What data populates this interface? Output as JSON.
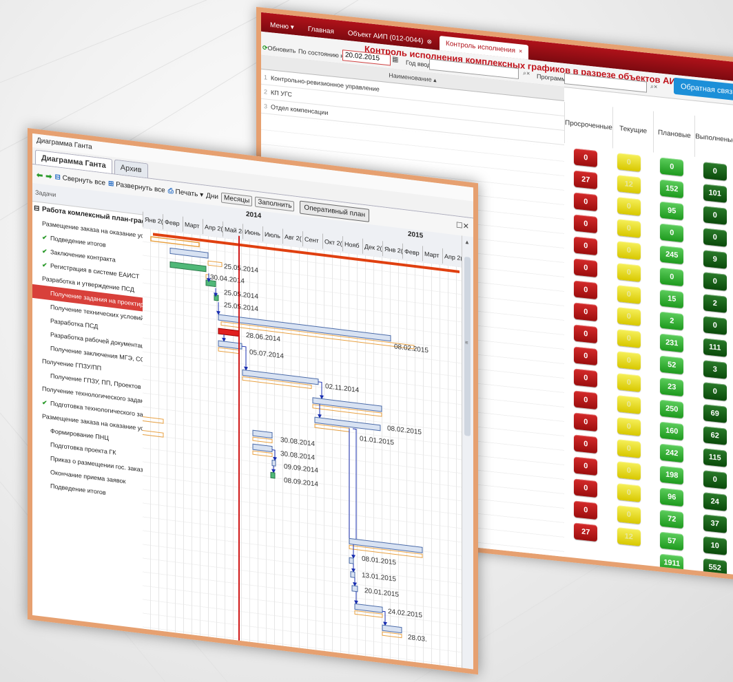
{
  "back_window": {
    "tabs": [
      {
        "label": "Меню ▾",
        "active": false,
        "closable": false
      },
      {
        "label": "Главная",
        "active": false,
        "closable": false
      },
      {
        "label": "Объект АИП (012-0044)",
        "active": false,
        "closable": true
      },
      {
        "label": "Контроль исполнения",
        "active": true,
        "closable": true
      }
    ],
    "title": "Контроль исполнения комплексных графиков в разрезе объектов АИП",
    "refresh_label": "Обновить",
    "state_label": "По состоянию на:",
    "state_date": "20.02.2015",
    "year_label": "Год ввода:",
    "program_label": "Программа:",
    "feedback_label": "Обратная связь",
    "name_column": "Наименование ▴",
    "rows": [
      {
        "n": "1",
        "label": "Контрольно-ревизионное управление"
      },
      {
        "n": "2",
        "label": "КП УГС"
      },
      {
        "n": "3",
        "label": "Отдел компенсации"
      }
    ],
    "status_headers": [
      "Просроченные",
      "Текущие",
      "Плановые",
      "Выполненые"
    ],
    "status_rows": [
      [
        "0",
        "0",
        "0",
        "0"
      ],
      [
        "27",
        "12",
        "152",
        "101"
      ],
      [
        "0",
        "0",
        "95",
        "0"
      ],
      [
        "0",
        "0",
        "0",
        "0"
      ],
      [
        "0",
        "0",
        "245",
        "9"
      ],
      [
        "0",
        "0",
        "0",
        "0"
      ],
      [
        "0",
        "0",
        "15",
        "2"
      ],
      [
        "0",
        "0",
        "2",
        "0"
      ],
      [
        "0",
        "0",
        "231",
        "111"
      ],
      [
        "0",
        "0",
        "52",
        "3"
      ],
      [
        "0",
        "0",
        "23",
        "0"
      ],
      [
        "0",
        "0",
        "250",
        "69"
      ],
      [
        "0",
        "0",
        "160",
        "62"
      ],
      [
        "0",
        "0",
        "242",
        "115"
      ],
      [
        "0",
        "0",
        "198",
        "0"
      ],
      [
        "0",
        "0",
        "96",
        "24"
      ],
      [
        "0",
        "0",
        "72",
        "37"
      ],
      [
        "27",
        "12",
        "57",
        "10"
      ],
      [
        "",
        "",
        "1911",
        "552"
      ]
    ],
    "colors": {
      "overdue": "#c01818",
      "current": "#e8dc10",
      "planned": "#2aa52a",
      "done": "#0c5a0c"
    }
  },
  "front_window": {
    "window_title": "Диаграмма Ганта",
    "tabs": [
      {
        "label": "Диаграмма Ганта",
        "active": true
      },
      {
        "label": "Архив",
        "active": false
      }
    ],
    "toolbar": {
      "collapse_all": "Свернуть все",
      "expand_all": "Развернуть все",
      "print": "Печать ▾",
      "days": "Дни",
      "months": "Месяцы",
      "fill": "Заполнить",
      "operative_plan": "Оперативный план"
    },
    "tasks_header": "Задачи",
    "tasks": [
      {
        "label": "Работа комлексный план-график",
        "level": 0,
        "done": false,
        "selected": false
      },
      {
        "label": "Размещение заказа на оказание услуг по испо...",
        "level": 1,
        "done": false,
        "selected": false
      },
      {
        "label": "Подведение итогов",
        "level": 2,
        "done": true,
        "selected": false
      },
      {
        "label": "Заключение контракта",
        "level": 2,
        "done": true,
        "selected": false
      },
      {
        "label": "Регистрация в системе ЕАИСТ",
        "level": 2,
        "done": true,
        "selected": false
      },
      {
        "label": "Разработка и утверждение ПСД",
        "level": 1,
        "done": false,
        "selected": false
      },
      {
        "label": "Получение задания на проектирование",
        "level": 2,
        "done": false,
        "selected": true
      },
      {
        "label": "Получение технических условий",
        "level": 2,
        "done": false,
        "selected": false
      },
      {
        "label": "Разработка ПСД",
        "level": 2,
        "done": false,
        "selected": false
      },
      {
        "label": "Разработка рабочей документации",
        "level": 2,
        "done": false,
        "selected": false
      },
      {
        "label": "Получение заключения МГЭ, ССР и утвер...",
        "level": 2,
        "done": false,
        "selected": false
      },
      {
        "label": "Получение ГПЗУ/ПП",
        "level": 1,
        "done": false,
        "selected": false
      },
      {
        "label": "Получение ГПЗУ, ПП, Проектов межев.",
        "level": 2,
        "done": false,
        "selected": false
      },
      {
        "label": "Получение технологического задания",
        "level": 1,
        "done": false,
        "selected": false
      },
      {
        "label": "Подготовка технологического задания",
        "level": 2,
        "done": true,
        "selected": false
      },
      {
        "label": "Размещение заказа на оказание услуг по испо...",
        "level": 1,
        "done": false,
        "selected": false
      },
      {
        "label": "Формирование ПНЦ",
        "level": 2,
        "done": false,
        "selected": false
      },
      {
        "label": "Подготовка проекта ГК",
        "level": 2,
        "done": false,
        "selected": false
      },
      {
        "label": "Приказ о размещении гос. заказа",
        "level": 2,
        "done": false,
        "selected": false
      },
      {
        "label": "Окончание приема заявок",
        "level": 2,
        "done": false,
        "selected": false
      },
      {
        "label": "Подведение итогов",
        "level": 2,
        "done": false,
        "selected": false
      }
    ],
    "years": [
      "2014",
      "2015"
    ],
    "months": [
      "Янв 2(",
      "Февр",
      "Март",
      "Апр 2(",
      "Май 2(",
      "Июнь",
      "Июль",
      "Авг 2(",
      "Сент",
      "Окт 2(",
      "Нояб",
      "Дек 2(",
      "Янв 2(",
      "Февр",
      "Март",
      "Апр 2("
    ],
    "dates": {
      "d1": "25.05.2014",
      "d2": "30.04.2014",
      "d3": "25.05.2014",
      "d4": "25.05.2014",
      "d5": "28.06.2014",
      "d6": "08.02.2015",
      "d7": "05.07.2014",
      "d8": "02.11.2014",
      "d9": "08.02.2015",
      "d10": "01.01.2015",
      "d11": "30.08.2014",
      "d12": "30.08.2014",
      "d13": "09.09.2014",
      "d14": "08.09.2014",
      "d15": "08.01.2015",
      "d16": "13.01.2015",
      "d17": "20.01.2015",
      "d18": "24.02.2015",
      "d19": "28.03."
    },
    "colors": {
      "plan_bar": "#e8a040",
      "fact_bar": "#d8e2f2",
      "done_bar": "#50b878",
      "late_bar": "#e02020",
      "today_line": "#d01818",
      "summary": "#e04010",
      "link": "#1a2fb0"
    }
  }
}
